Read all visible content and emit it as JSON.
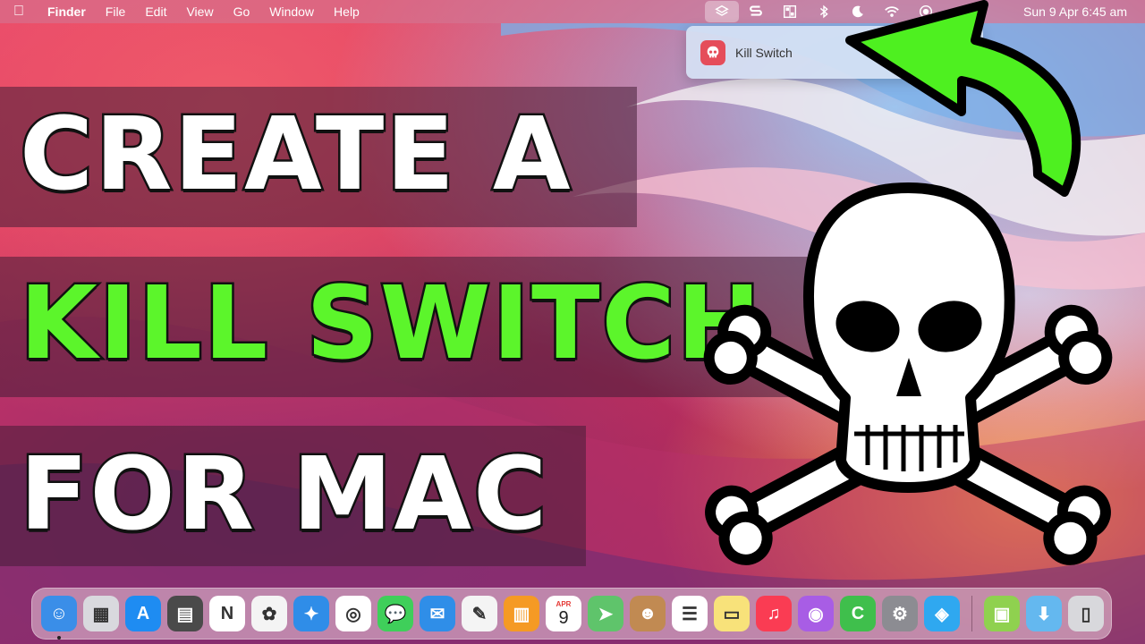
{
  "menubar": {
    "app_name": "Finder",
    "menus": [
      "File",
      "Edit",
      "View",
      "Go",
      "Window",
      "Help"
    ],
    "status_icons": [
      "layers-icon",
      "scribe-icon",
      "control-grid-icon",
      "bluetooth-icon",
      "moon-icon",
      "wifi-icon",
      "record-icon"
    ],
    "clock": "Sun 9 Apr  6:45 am"
  },
  "dropdown": {
    "item_label": "Kill Switch"
  },
  "title": {
    "line1": "CREATE A",
    "line2": "KILL SWITCH",
    "line3": "FOR MAC"
  },
  "colors": {
    "title_white": "#ffffff",
    "title_green": "#5cf52b",
    "arrow_green": "#4ef020",
    "kill_switch_red": "#e54d5a"
  },
  "dock": {
    "apps": [
      {
        "name": "finder-icon",
        "color": "#3a8ee8"
      },
      {
        "name": "launchpad-icon",
        "color": "#d9d9de"
      },
      {
        "name": "app-store-icon",
        "color": "#1e8cf2"
      },
      {
        "name": "calculator-icon",
        "color": "#4a4a4a"
      },
      {
        "name": "notion-icon",
        "color": "#ffffff"
      },
      {
        "name": "photos-icon",
        "color": "#f4f4f4"
      },
      {
        "name": "safari-icon",
        "color": "#2f8de8"
      },
      {
        "name": "chrome-icon",
        "color": "#ffffff"
      },
      {
        "name": "messages-icon",
        "color": "#3fcf5a"
      },
      {
        "name": "mail-icon",
        "color": "#2f8ee8"
      },
      {
        "name": "textedit-icon",
        "color": "#f4f4f4"
      },
      {
        "name": "books-icon",
        "color": "#f59a24"
      },
      {
        "name": "calendar-icon",
        "color": "#ffffff"
      },
      {
        "name": "maps-icon",
        "color": "#5fc46b"
      },
      {
        "name": "contacts-icon",
        "color": "#c18a52"
      },
      {
        "name": "reminders-icon",
        "color": "#ffffff"
      },
      {
        "name": "notes-icon",
        "color": "#f8e27a"
      },
      {
        "name": "music-icon",
        "color": "#fa3c53"
      },
      {
        "name": "podcasts-icon",
        "color": "#a85de5"
      },
      {
        "name": "camtasia-icon",
        "color": "#3fbf4c"
      },
      {
        "name": "system-preferences-icon",
        "color": "#8c8c92"
      },
      {
        "name": "shortcuts-icon",
        "color": "#2fa8f0"
      }
    ],
    "trailing": [
      {
        "name": "installer-icon",
        "color": "#8fd14f"
      },
      {
        "name": "downloads-folder-icon",
        "color": "#64b8ef"
      },
      {
        "name": "trash-icon",
        "color": "#d8d8dc"
      }
    ],
    "calendar_month": "APR",
    "calendar_day": "9"
  }
}
